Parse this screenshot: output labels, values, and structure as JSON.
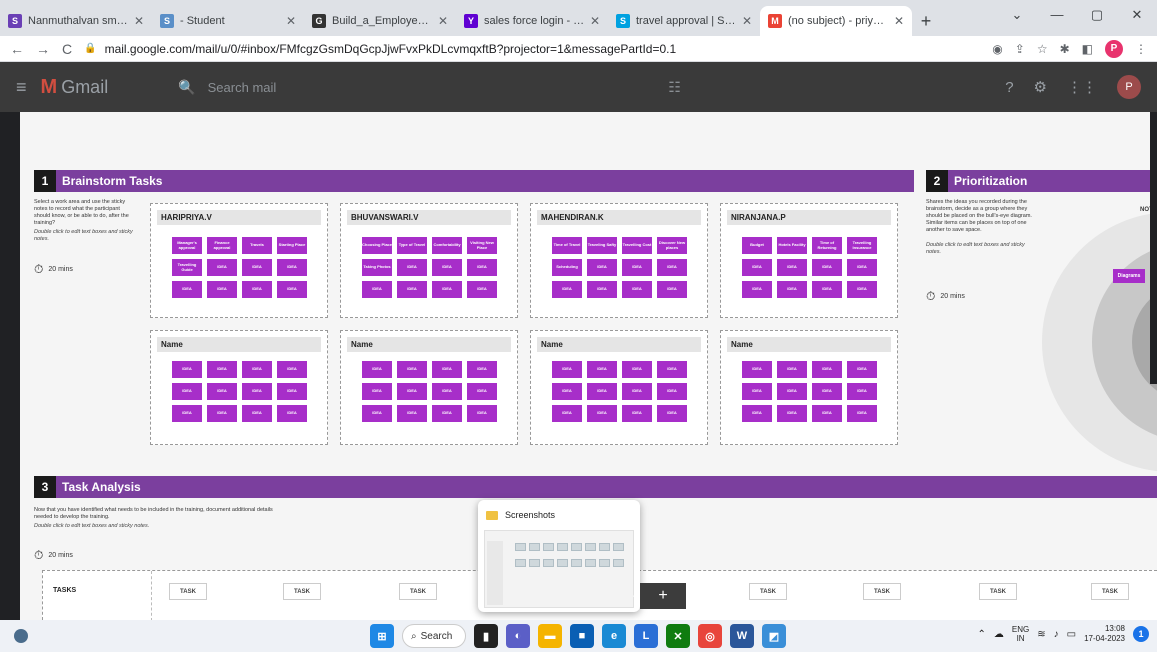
{
  "browser": {
    "tabs": [
      {
        "title": "Nanmuthalvan smartinternz",
        "icon": "smartinternz-icon",
        "color": "#6a3fb5",
        "glyph": "S"
      },
      {
        "title": "- Student",
        "icon": "student-icon",
        "color": "#5a8fc8",
        "glyph": "S"
      },
      {
        "title": "Build_a_Employee_Travel_A",
        "icon": "github-icon",
        "color": "#333333",
        "glyph": "G"
      },
      {
        "title": "sales force login - Yahoo In",
        "icon": "yahoo-icon",
        "color": "#6001d2",
        "glyph": "Y"
      },
      {
        "title": "travel approval | Salesforce",
        "icon": "salesforce-icon",
        "color": "#00a1e0",
        "glyph": "S"
      },
      {
        "title": "(no subject) - priyadharshin",
        "icon": "gmail-icon",
        "color": "#ea4335",
        "glyph": "M"
      }
    ],
    "url": "mail.google.com/mail/u/0/#inbox/FMfcgzGsmDqGcpJjwFvxPkDLcvmqxftB?projector=1&messagePartId=0.1",
    "profile_initial": "P"
  },
  "gmail": {
    "app_name": "Gmail",
    "search_placeholder": "Search mail",
    "avatar_initial": "P"
  },
  "board": {
    "brainstorm": {
      "number": "1",
      "title": "Brainstorm Tasks",
      "instructions": "Select a work area and use the sticky notes to record what the participant should know, or be able to do, after the training?",
      "hint": "Double click to edit text boxes and sticky notes.",
      "timer": "20 mins",
      "groups": [
        {
          "name": "HARIPRIYA.V",
          "notes": [
            "Manager's approval",
            "Finance approval",
            "Travels",
            "Starting Place",
            "Travelling Guide",
            "IDEA",
            "IDEA",
            "IDEA",
            "IDEA",
            "IDEA",
            "IDEA",
            "IDEA"
          ]
        },
        {
          "name": "BHUVANSWARI.V",
          "notes": [
            "Choosing Place",
            "Type of Travel",
            "Comfortability",
            "Visiting New Place",
            "Taking Photos",
            "IDEA",
            "IDEA",
            "IDEA",
            "IDEA",
            "IDEA",
            "IDEA",
            "IDEA"
          ]
        },
        {
          "name": "MAHENDIRAN.K",
          "notes": [
            "Time of Travel",
            "Traveling Safty",
            "Travelling Cost",
            "Discover New places",
            "Scheduling",
            "IDEA",
            "IDEA",
            "IDEA",
            "IDEA",
            "IDEA",
            "IDEA",
            "IDEA"
          ]
        },
        {
          "name": "NIRANJANA.P",
          "notes": [
            "Budget",
            "Hotels Facility",
            "Time of Returning",
            "Travelling Insurance",
            "IDEA",
            "IDEA",
            "IDEA",
            "IDEA",
            "IDEA",
            "IDEA",
            "IDEA",
            "IDEA"
          ]
        },
        {
          "name": "Name",
          "notes": [
            "IDEA",
            "IDEA",
            "IDEA",
            "IDEA",
            "IDEA",
            "IDEA",
            "IDEA",
            "IDEA",
            "IDEA",
            "IDEA",
            "IDEA",
            "IDEA"
          ]
        },
        {
          "name": "Name",
          "notes": [
            "IDEA",
            "IDEA",
            "IDEA",
            "IDEA",
            "IDEA",
            "IDEA",
            "IDEA",
            "IDEA",
            "IDEA",
            "IDEA",
            "IDEA",
            "IDEA"
          ]
        },
        {
          "name": "Name",
          "notes": [
            "IDEA",
            "IDEA",
            "IDEA",
            "IDEA",
            "IDEA",
            "IDEA",
            "IDEA",
            "IDEA",
            "IDEA",
            "IDEA",
            "IDEA",
            "IDEA"
          ]
        },
        {
          "name": "Name",
          "notes": [
            "IDEA",
            "IDEA",
            "IDEA",
            "IDEA",
            "IDEA",
            "IDEA",
            "IDEA",
            "IDEA",
            "IDEA",
            "IDEA",
            "IDEA",
            "IDEA"
          ]
        }
      ]
    },
    "prioritization": {
      "number": "2",
      "title": "Prioritization",
      "instructions": "Shares the ideas you recorded during the brainstorm, decide as a group where they should be placed on the bull's-eye diagram. Similar items can be places on top of one another to save space.",
      "hint": "Double click to edit text boxes and sticky notes.",
      "timer": "20 mins",
      "ring_label": "NOT",
      "note_label": "Diagrams"
    },
    "task_analysis": {
      "number": "3",
      "title": "Task Analysis",
      "instructions": "Now that you have identified what needs to be included in the training, document additional details needed to develop the training.",
      "hint": "Double click to edit text boxes and sticky notes.",
      "timer": "20 mins",
      "row_label": "TASKS",
      "task_label": "TASK"
    }
  },
  "popup": {
    "title": "Screenshots"
  },
  "taskbar": {
    "search_label": "Search",
    "lang_top": "ENG",
    "lang_bottom": "IN",
    "time": "13:08",
    "date": "17-04-2023",
    "notif_count": "1"
  }
}
